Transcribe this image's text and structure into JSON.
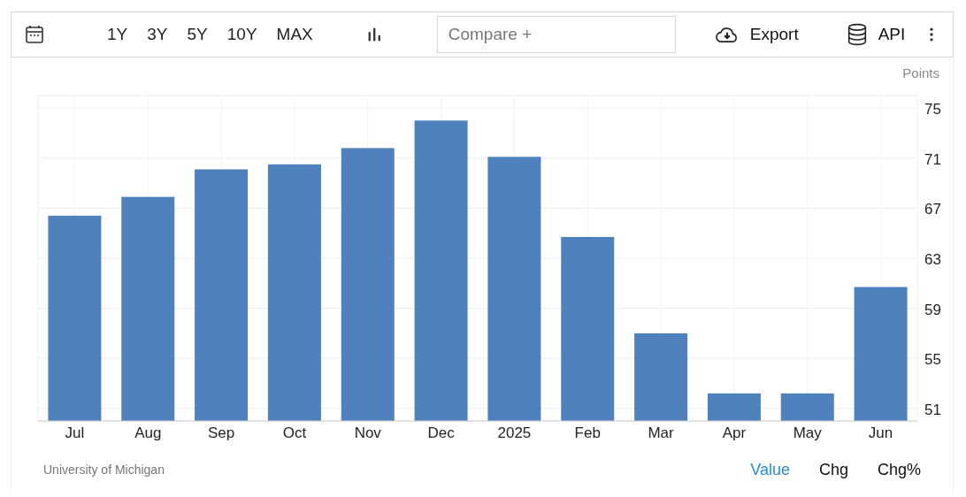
{
  "toolbar": {
    "ranges": [
      {
        "label": "1Y",
        "selected": false
      },
      {
        "label": "3Y",
        "selected": false
      },
      {
        "label": "5Y",
        "selected": false
      },
      {
        "label": "10Y",
        "selected": false
      },
      {
        "label": "MAX",
        "selected": false
      }
    ],
    "compare": {
      "placeholder": "Compare +"
    },
    "export": "Export",
    "api": "API"
  },
  "chart": {
    "chart_data": {
      "type": "bar",
      "ylabel": "Points",
      "categories": [
        "Jul",
        "Aug",
        "Sep",
        "Oct",
        "Nov",
        "Dec",
        "2025",
        "Feb",
        "Mar",
        "Apr",
        "May",
        "Jun"
      ],
      "grid": true,
      "series": [
        {
          "color": "#4f81bd",
          "values": [
            66.4,
            67.9,
            70.1,
            70.5,
            71.8,
            74.0,
            71.1,
            64.7,
            57.0,
            52.2,
            52.2,
            60.7
          ]
        }
      ],
      "ylim": [
        50,
        76
      ],
      "yticks": [
        51,
        55,
        59,
        63,
        67,
        71,
        75
      ]
    }
  },
  "source": "University of Michigan",
  "view_tabs": [
    {
      "label": "Value",
      "selected": true
    },
    {
      "label": "Chg",
      "selected": false
    },
    {
      "label": "Chg%",
      "selected": false
    }
  ]
}
